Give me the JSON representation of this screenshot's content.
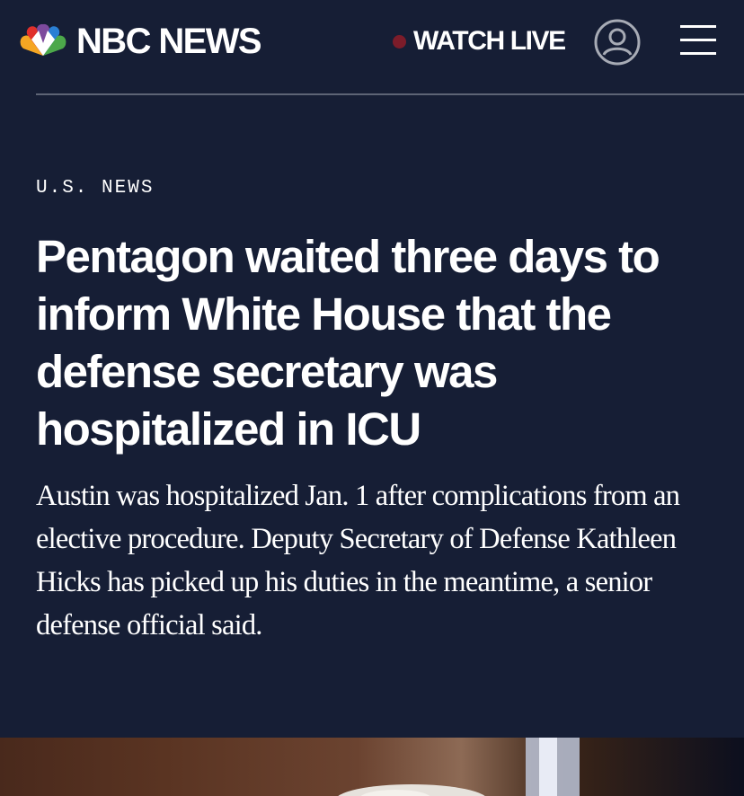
{
  "header": {
    "brand": "NBC NEWS",
    "logo_icon": "nbc-peacock-icon",
    "watch_live_label": "WATCH LIVE",
    "live_dot_color": "#7c1c2a",
    "account_icon": "user-account-icon",
    "menu_icon": "hamburger-menu-icon"
  },
  "article": {
    "section": "U.S. NEWS",
    "headline": "Pentagon waited three days to inform White House that the defense secretary was hospitalized in ICU",
    "dek": "Austin was hospitalized Jan. 1 after complications from an elective procedure. Deputy Secretary of Defense Kathleen Hicks has picked up his duties in the meantime, a senior defense official said."
  },
  "colors": {
    "background": "#161e35",
    "text": "#ffffff",
    "divider": "#5d6475"
  }
}
